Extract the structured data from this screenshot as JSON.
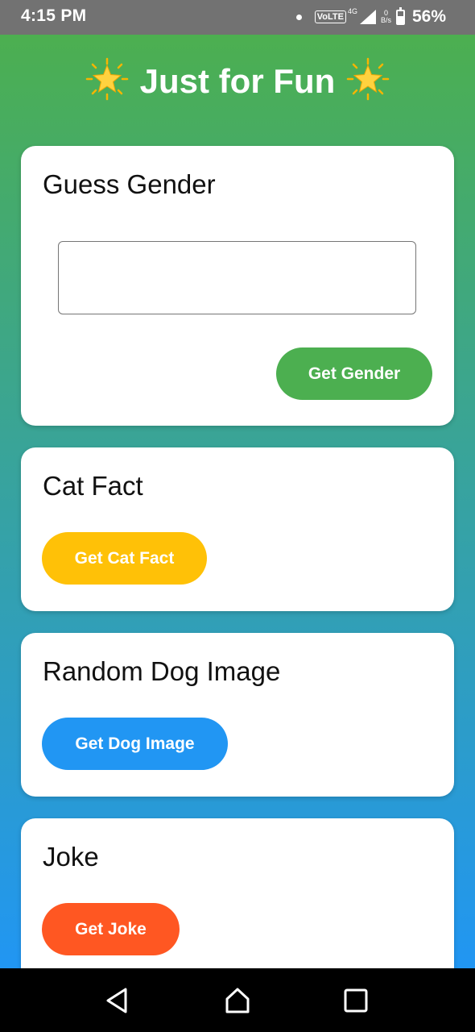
{
  "status_bar": {
    "time": "4:15 PM",
    "volte": "VoLTE",
    "network": "4G",
    "data_rate_top": "0",
    "data_rate_unit": "B/s",
    "battery": "56%",
    "battery_level": 0.56
  },
  "header": {
    "title": "Just for Fun",
    "icon_left": "glowing-star-icon",
    "icon_right": "glowing-star-icon"
  },
  "cards": {
    "gender": {
      "title": "Guess Gender",
      "input_value": "",
      "button_label": "Get Gender",
      "button_color": "#4caf50"
    },
    "cat": {
      "title": "Cat Fact",
      "button_label": "Get Cat Fact",
      "button_color": "#ffc107"
    },
    "dog": {
      "title": "Random Dog Image",
      "button_label": "Get Dog Image",
      "button_color": "#2196f3"
    },
    "joke": {
      "title": "Joke",
      "button_label": "Get Joke",
      "button_color": "#ff5722"
    }
  },
  "theme": {
    "gradient_top": "#4caf50",
    "gradient_bottom": "#2196f3"
  },
  "nav_bar": {
    "back_icon": "back-triangle-icon",
    "home_icon": "home-icon",
    "recents_icon": "recents-square-icon"
  }
}
